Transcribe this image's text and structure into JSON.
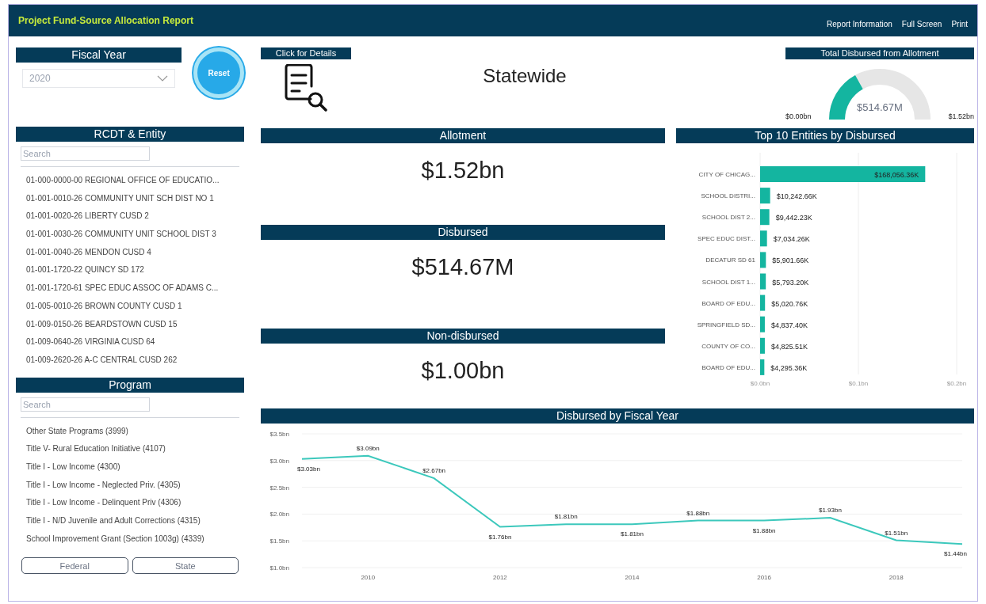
{
  "header": {
    "title": "Project Fund-Source Allocation Report",
    "links": [
      "Report Information",
      "Full Screen",
      "Print"
    ]
  },
  "fiscal_year": {
    "title": "Fiscal Year",
    "value": "2020"
  },
  "reset_button": {
    "label": "Reset"
  },
  "entity_slicer": {
    "title": "RCDT & Entity",
    "search": {
      "placeholder": "Search"
    },
    "items": [
      "01-000-0000-00 REGIONAL OFFICE OF EDUCATIO...",
      "01-001-0010-26 COMMUNITY UNIT SCH DIST NO 1",
      "01-001-0020-26 LIBERTY CUSD 2",
      "01-001-0030-26 COMMUNITY UNIT SCHOOL DIST 3",
      "01-001-0040-26 MENDON CUSD 4",
      "01-001-1720-22 QUINCY SD 172",
      "01-001-1720-61 SPEC EDUC ASSOC OF ADAMS C...",
      "01-005-0010-26 BROWN COUNTY CUSD 1",
      "01-009-0150-26 BEARDSTOWN CUSD 15",
      "01-009-0640-26 VIRGINIA CUSD 64",
      "01-009-2620-26 A-C CENTRAL CUSD 262"
    ]
  },
  "program_slicer": {
    "title": "Program",
    "search": {
      "placeholder": "Search"
    },
    "items": [
      "Other State Programs (3999)",
      "Title V- Rural Education Initiative (4107)",
      "Title I - Low Income (4300)",
      "Title I - Low Income - Neglected Priv. (4305)",
      "Title I - Low Income - Delinquent Priv (4306)",
      "Title I - N/D Juvenile and Adult Corrections (4315)",
      "School Improvement Grant (Section 1003g) (4339)"
    ]
  },
  "source_buttons": [
    "Federal",
    "State"
  ],
  "details_button": {
    "label": "Click for Details"
  },
  "scope_title": "Statewide",
  "gauge": {
    "title": "Total Disbursed from Allotment",
    "value": "$514.67M",
    "min": "$0.00bn",
    "max": "$1.52bn"
  },
  "kpis": [
    {
      "title": "Allotment",
      "value": "$1.52bn"
    },
    {
      "title": "Disbursed",
      "value": "$514.67M"
    },
    {
      "title": "Non-disbursed",
      "value": "$1.00bn"
    }
  ],
  "top_entities": {
    "title": "Top 10 Entities by Disbursed",
    "chart_data": {
      "type": "bar",
      "orientation": "horizontal",
      "categories": [
        "CITY OF CHICAG...",
        "SCHOOL DISTRI...",
        "SCHOOL DIST 2...",
        "SPEC EDUC DIST...",
        "DECATUR SD 61",
        "SCHOOL DIST 1...",
        "BOARD OF EDU...",
        "SPRINGFIELD SD...",
        "COUNTY OF CO...",
        "BOARD OF EDU..."
      ],
      "values": [
        0.168,
        0.0102,
        0.0094,
        0.007,
        0.0059,
        0.0058,
        0.005,
        0.0048,
        0.0048,
        0.0043
      ],
      "grid": true,
      "xlim": [
        0,
        0.2
      ],
      "xticks": [
        {
          "value": 0,
          "label": "$0.0bn"
        },
        {
          "value": 0.1,
          "label": "$0.1bn"
        },
        {
          "value": 0.2,
          "label": "$0.2bn"
        }
      ]
    },
    "bar_labels": [
      "$168,056.36K",
      "$10,242.66K",
      "$9,442.23K",
      "$7,034.26K",
      "$5,901.66K",
      "$5,793.20K",
      "$5,020.76K",
      "$4,837.40K",
      "$4,825.51K",
      "$4,295.36K"
    ]
  },
  "by_year": {
    "title": "Disbursed by Fiscal Year",
    "chart_data": {
      "type": "line",
      "x": [
        2009,
        2010,
        2011,
        2012,
        2013,
        2014,
        2015,
        2016,
        2017,
        2018,
        2019
      ],
      "series": [
        {
          "color": "#3cc8bc",
          "values": [
            3.03,
            3.09,
            2.67,
            1.76,
            1.81,
            1.81,
            1.88,
            1.88,
            1.93,
            1.51,
            1.44
          ]
        }
      ],
      "grid": true,
      "value_labels": [
        "$3.03bn",
        "$3.09bn",
        "$2.67bn",
        "$1.76bn",
        "$1.81bn",
        "$1.81bn",
        "$1.88bn",
        "$1.88bn",
        "$1.93bn",
        "$1.51bn",
        "$1.44bn"
      ],
      "xlim": [
        2009,
        2019
      ],
      "ylim": [
        1.0,
        3.5
      ],
      "xticks": [
        2010,
        2012,
        2014,
        2016,
        2018
      ],
      "yticks": [
        {
          "value": 1.0,
          "label": "$1.0bn"
        },
        {
          "value": 1.5,
          "label": "$1.5bn"
        },
        {
          "value": 2.0,
          "label": "$2.0bn"
        },
        {
          "value": 2.5,
          "label": "$2.5bn"
        },
        {
          "value": 3.0,
          "label": "$3.0bn"
        },
        {
          "value": 3.5,
          "label": "$3.5bn"
        }
      ]
    }
  }
}
